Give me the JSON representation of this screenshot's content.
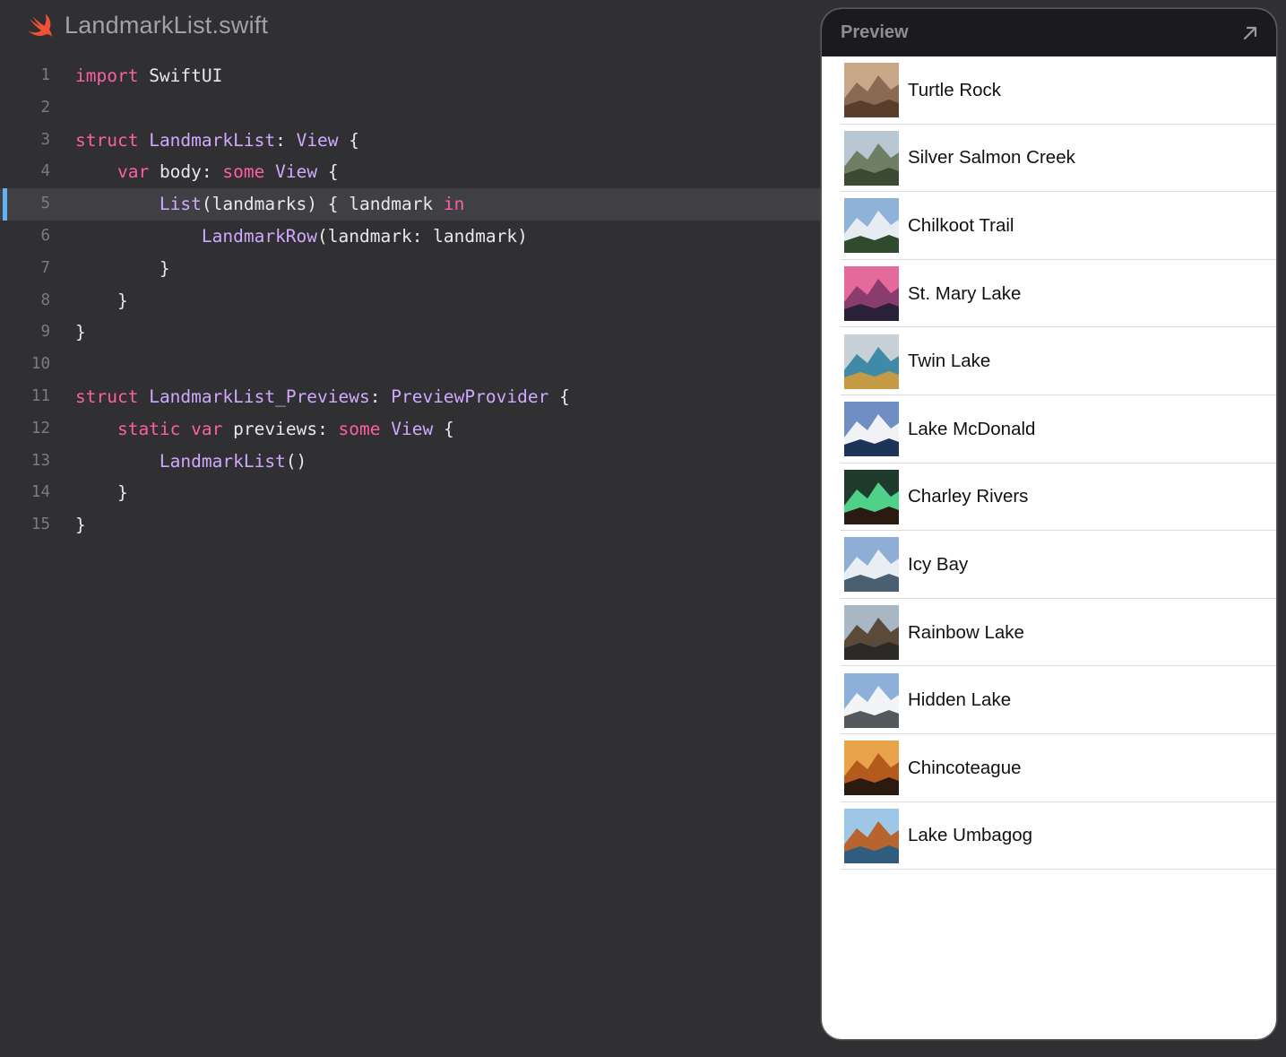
{
  "file": {
    "name": "LandmarkList.swift",
    "icon": "swift-icon",
    "icon_color": "#f05138"
  },
  "editor": {
    "active_line": 5,
    "lines": [
      {
        "num": "1",
        "tokens": [
          {
            "t": "kw",
            "v": "import"
          },
          {
            "t": "pl",
            "v": " SwiftUI"
          }
        ]
      },
      {
        "num": "2",
        "tokens": []
      },
      {
        "num": "3",
        "tokens": [
          {
            "t": "kw",
            "v": "struct"
          },
          {
            "t": "pl",
            "v": " "
          },
          {
            "t": "ty",
            "v": "LandmarkList"
          },
          {
            "t": "pl",
            "v": ": "
          },
          {
            "t": "ty",
            "v": "View"
          },
          {
            "t": "pl",
            "v": " {"
          }
        ]
      },
      {
        "num": "4",
        "tokens": [
          {
            "t": "pl",
            "v": "    "
          },
          {
            "t": "kw",
            "v": "var"
          },
          {
            "t": "pl",
            "v": " body: "
          },
          {
            "t": "kw",
            "v": "some"
          },
          {
            "t": "pl",
            "v": " "
          },
          {
            "t": "ty",
            "v": "View"
          },
          {
            "t": "pl",
            "v": " {"
          }
        ]
      },
      {
        "num": "5",
        "tokens": [
          {
            "t": "pl",
            "v": "        "
          },
          {
            "t": "ty",
            "v": "List"
          },
          {
            "t": "pl",
            "v": "(landmarks) { landmark "
          },
          {
            "t": "kw",
            "v": "in"
          }
        ]
      },
      {
        "num": "6",
        "tokens": [
          {
            "t": "pl",
            "v": "            "
          },
          {
            "t": "ty",
            "v": "LandmarkRow"
          },
          {
            "t": "pl",
            "v": "(landmark: landmark)"
          }
        ]
      },
      {
        "num": "7",
        "tokens": [
          {
            "t": "pl",
            "v": "        }"
          }
        ]
      },
      {
        "num": "8",
        "tokens": [
          {
            "t": "pl",
            "v": "    }"
          }
        ]
      },
      {
        "num": "9",
        "tokens": [
          {
            "t": "pl",
            "v": "}"
          }
        ]
      },
      {
        "num": "10",
        "tokens": []
      },
      {
        "num": "11",
        "tokens": [
          {
            "t": "kw",
            "v": "struct"
          },
          {
            "t": "pl",
            "v": " "
          },
          {
            "t": "ty",
            "v": "LandmarkList_Previews"
          },
          {
            "t": "pl",
            "v": ": "
          },
          {
            "t": "ty",
            "v": "PreviewProvider"
          },
          {
            "t": "pl",
            "v": " {"
          }
        ]
      },
      {
        "num": "12",
        "tokens": [
          {
            "t": "pl",
            "v": "    "
          },
          {
            "t": "kw",
            "v": "static"
          },
          {
            "t": "pl",
            "v": " "
          },
          {
            "t": "kw",
            "v": "var"
          },
          {
            "t": "pl",
            "v": " previews: "
          },
          {
            "t": "kw",
            "v": "some"
          },
          {
            "t": "pl",
            "v": " "
          },
          {
            "t": "ty",
            "v": "View"
          },
          {
            "t": "pl",
            "v": " {"
          }
        ]
      },
      {
        "num": "13",
        "tokens": [
          {
            "t": "pl",
            "v": "        "
          },
          {
            "t": "ty",
            "v": "LandmarkList"
          },
          {
            "t": "pl",
            "v": "()"
          }
        ]
      },
      {
        "num": "14",
        "tokens": [
          {
            "t": "pl",
            "v": "    }"
          }
        ]
      },
      {
        "num": "15",
        "tokens": [
          {
            "t": "pl",
            "v": "}"
          }
        ]
      }
    ]
  },
  "preview": {
    "title": "Preview",
    "expand_icon": "expand-arrow-icon",
    "landmarks": [
      {
        "name": "Turtle Rock",
        "colors": [
          "#c9a889",
          "#8a6a52",
          "#5a3d2b"
        ]
      },
      {
        "name": "Silver Salmon Creek",
        "colors": [
          "#b9c7d3",
          "#6f7f66",
          "#3c4a34"
        ]
      },
      {
        "name": "Chilkoot Trail",
        "colors": [
          "#8fb2d8",
          "#e6ecf2",
          "#2f4a2c"
        ]
      },
      {
        "name": "St. Mary Lake",
        "colors": [
          "#e36a9a",
          "#8a3c6e",
          "#2a2138"
        ]
      },
      {
        "name": "Twin Lake",
        "colors": [
          "#c7d0d6",
          "#3f8aa6",
          "#c59a45"
        ]
      },
      {
        "name": "Lake McDonald",
        "colors": [
          "#6f8fc4",
          "#f0f2f6",
          "#1d3358"
        ]
      },
      {
        "name": "Charley Rivers",
        "colors": [
          "#1f3b2c",
          "#4fd18a",
          "#2a1a12"
        ]
      },
      {
        "name": "Icy Bay",
        "colors": [
          "#8faed6",
          "#e9eef3",
          "#4b5f72"
        ]
      },
      {
        "name": "Rainbow Lake",
        "colors": [
          "#a9b6c4",
          "#5b4a3a",
          "#2c2a26"
        ]
      },
      {
        "name": "Hidden Lake",
        "colors": [
          "#8cb0da",
          "#f2f4f6",
          "#55585c"
        ]
      },
      {
        "name": "Chincoteague",
        "colors": [
          "#e9a34a",
          "#b45a1c",
          "#2b1a10"
        ]
      },
      {
        "name": "Lake Umbagog",
        "colors": [
          "#9ec6e6",
          "#b8642e",
          "#2f5c7f"
        ]
      }
    ]
  }
}
